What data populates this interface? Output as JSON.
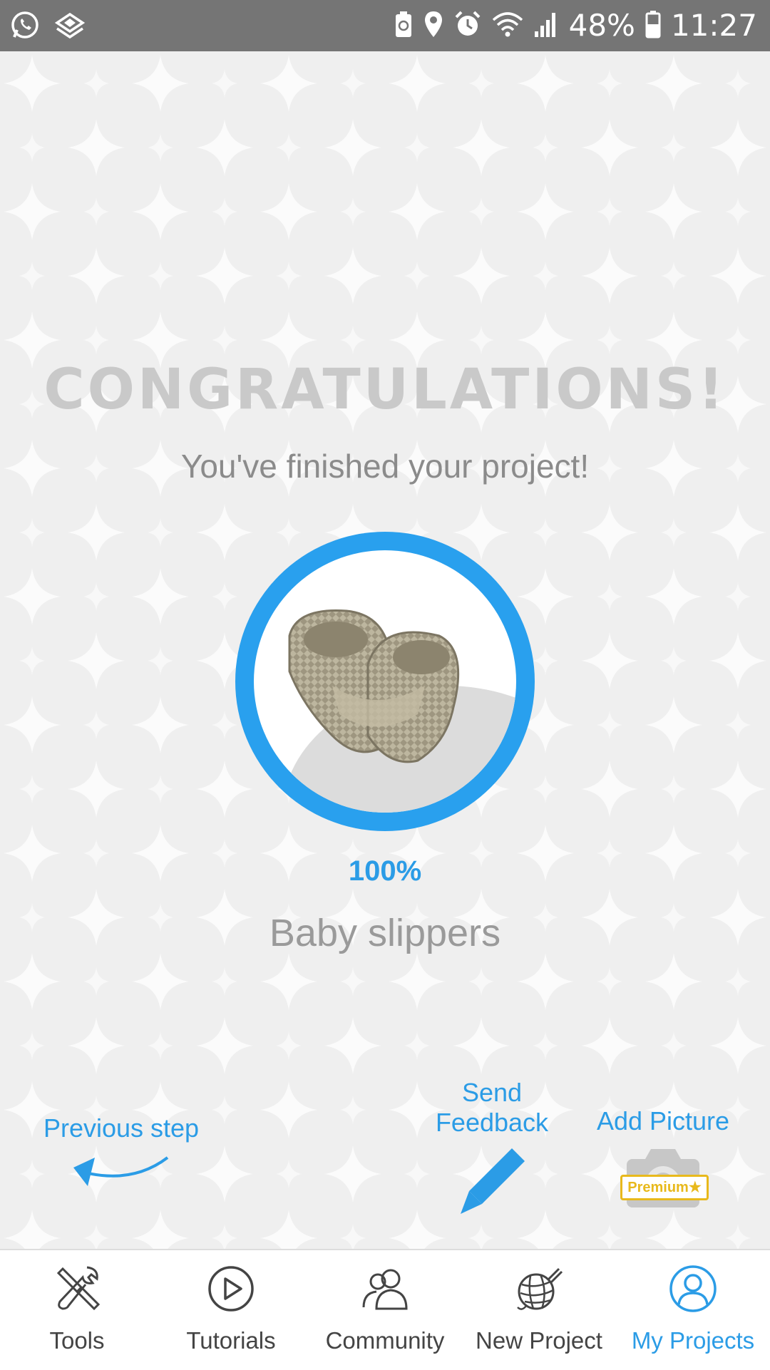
{
  "status_bar": {
    "battery": "48%",
    "time": "11:27",
    "icons": [
      "whatsapp-icon",
      "stack-icon",
      "recycle-icon",
      "location-icon",
      "alarm-icon",
      "wifi-icon",
      "signal-icon",
      "battery-icon"
    ]
  },
  "main": {
    "title": "CONGRATULATIONS!",
    "subtitle": "You've finished your project!",
    "progress_percent": "100%",
    "progress_value": 1.0,
    "project_name": "Baby slippers",
    "image": "baby-slippers-photo"
  },
  "actions": {
    "previous_step": "Previous step",
    "send_feedback_line1": "Send",
    "send_feedback_line2": "Feedback",
    "add_picture": "Add Picture",
    "premium_badge": "Premium"
  },
  "nav": {
    "items": [
      {
        "label": "Tools",
        "icon": "tools-icon"
      },
      {
        "label": "Tutorials",
        "icon": "play-icon"
      },
      {
        "label": "Community",
        "icon": "community-icon"
      },
      {
        "label": "New Project",
        "icon": "yarn-icon"
      },
      {
        "label": "My Projects",
        "icon": "profile-icon"
      }
    ],
    "active_index": 4
  },
  "colors": {
    "accent": "#2b9ce6",
    "status_bar": "#757575",
    "background": "#efefef",
    "premium": "#e8b91c"
  }
}
